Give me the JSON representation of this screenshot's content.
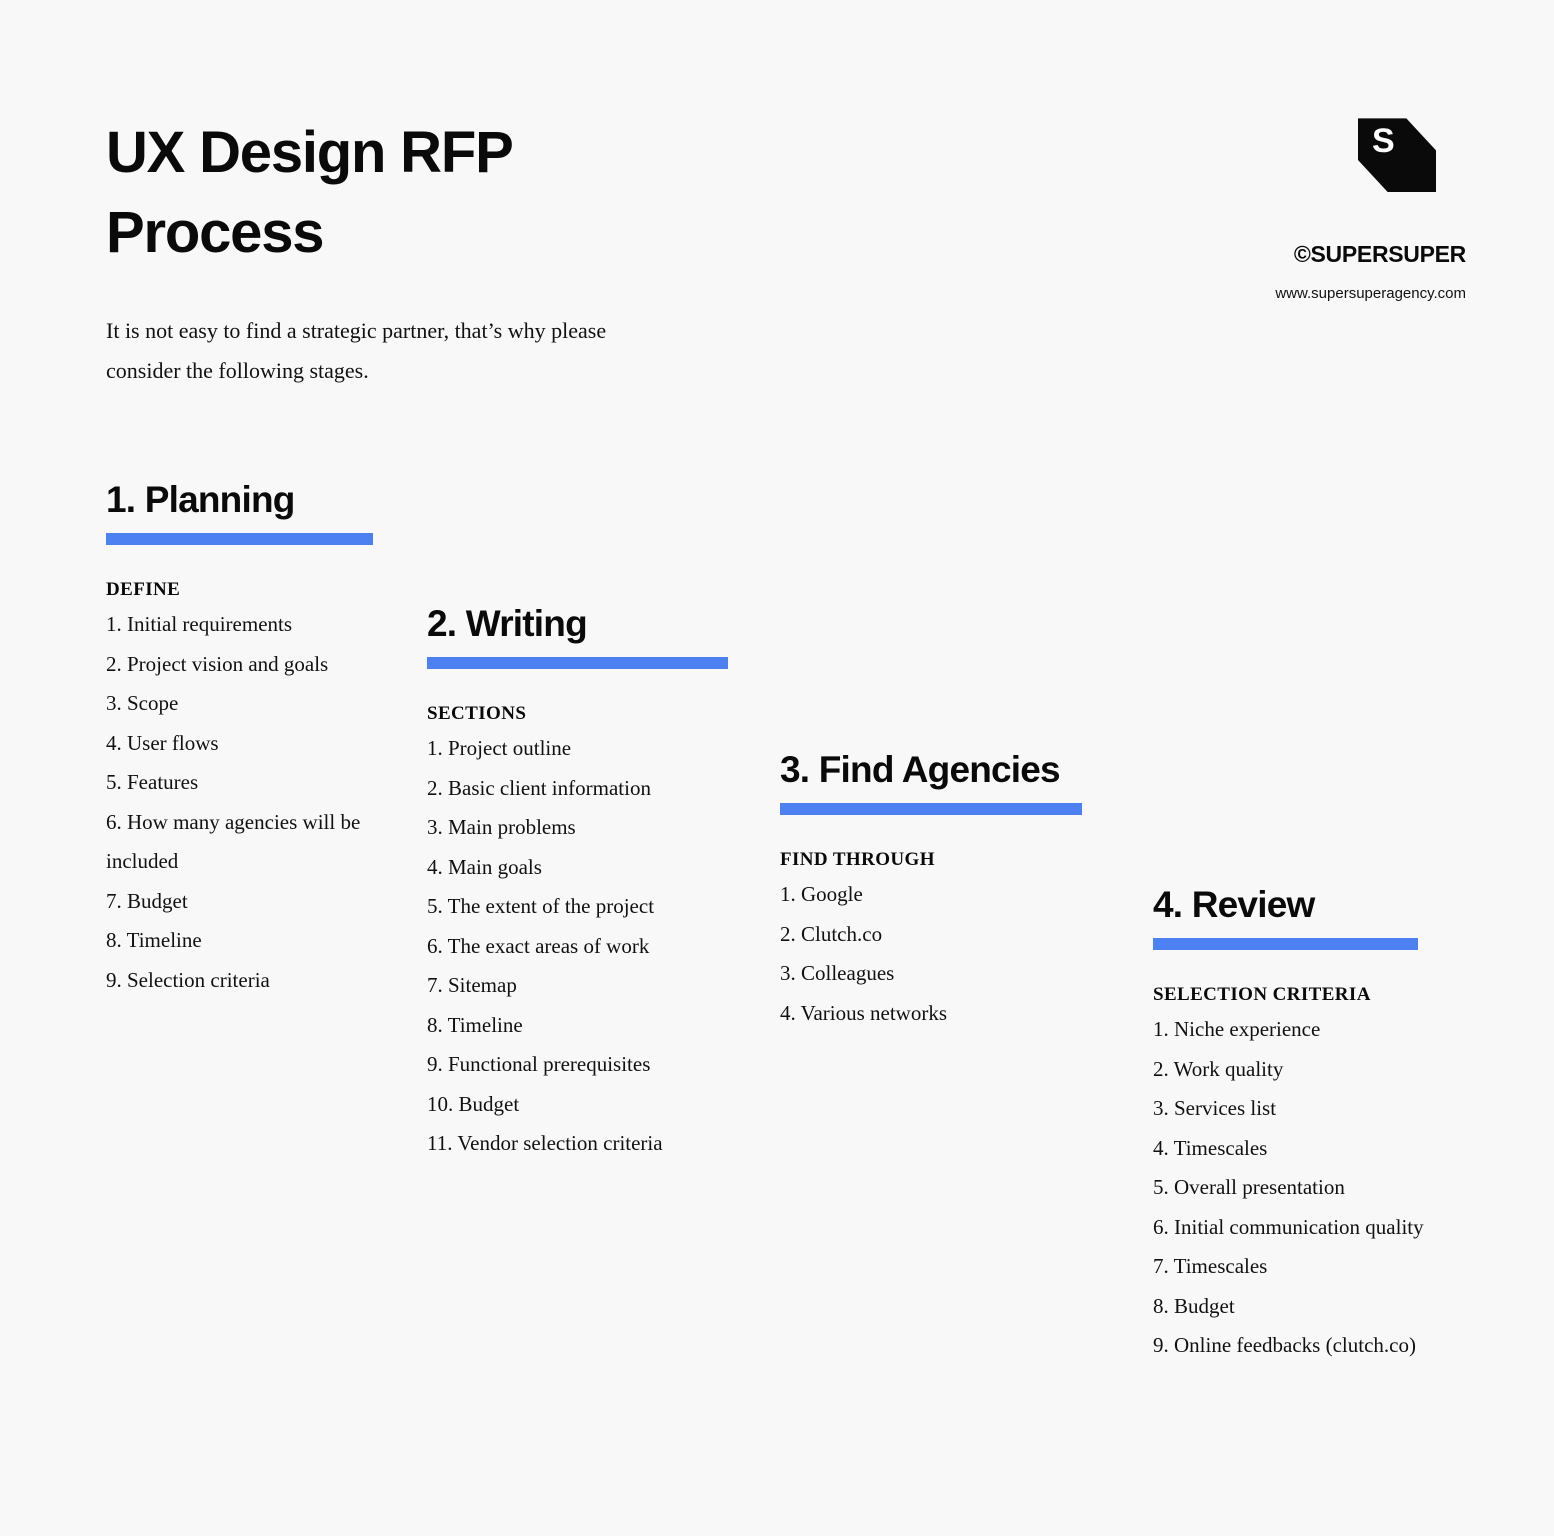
{
  "document": {
    "title": "UX Design RFP Process",
    "subtitle": "It is not easy to find a strategic partner, that’s why please consider the following stages."
  },
  "brand": {
    "logo_letter": "S",
    "logo_icon": "tag-logo-icon",
    "name": "©SUPERSUPER",
    "url": "www.supersuperagency.com"
  },
  "accent_color": "#4d80f0",
  "background_color": "#f8f8f8",
  "steps": [
    {
      "title": "1. Planning",
      "label": "DEFINE",
      "items": [
        "1. Initial requirements",
        "2. Project vision and goals",
        "3. Scope",
        "4. User flows",
        "5. Features",
        "6. How many agencies will be included",
        "7. Budget",
        "8. Timeline",
        "9. Selection criteria"
      ]
    },
    {
      "title": "2. Writing",
      "label": "SECTIONS",
      "items": [
        "1. Project outline",
        "2. Basic client information",
        "3. Main problems",
        "4. Main goals",
        "5. The extent of the project",
        "6. The exact areas of work",
        "7. Sitemap",
        "8. Timeline",
        "9. Functional prerequisites",
        "10. Budget",
        "11. Vendor selection criteria"
      ]
    },
    {
      "title": "3. Find Agencies",
      "label": "FIND THROUGH",
      "items": [
        "1. Google",
        "2. Clutch.co",
        "3. Colleagues",
        "4. Various networks"
      ]
    },
    {
      "title": "4. Review",
      "label": "SELECTION CRITERIA",
      "items": [
        "1. Niche experience",
        "2. Work quality",
        "3. Services list",
        "4. Timescales",
        "5. Overall presentation",
        "6. Initial communication quality",
        "7. Timescales",
        "8. Budget",
        "9. Online feedbacks (clutch.co)"
      ]
    }
  ]
}
